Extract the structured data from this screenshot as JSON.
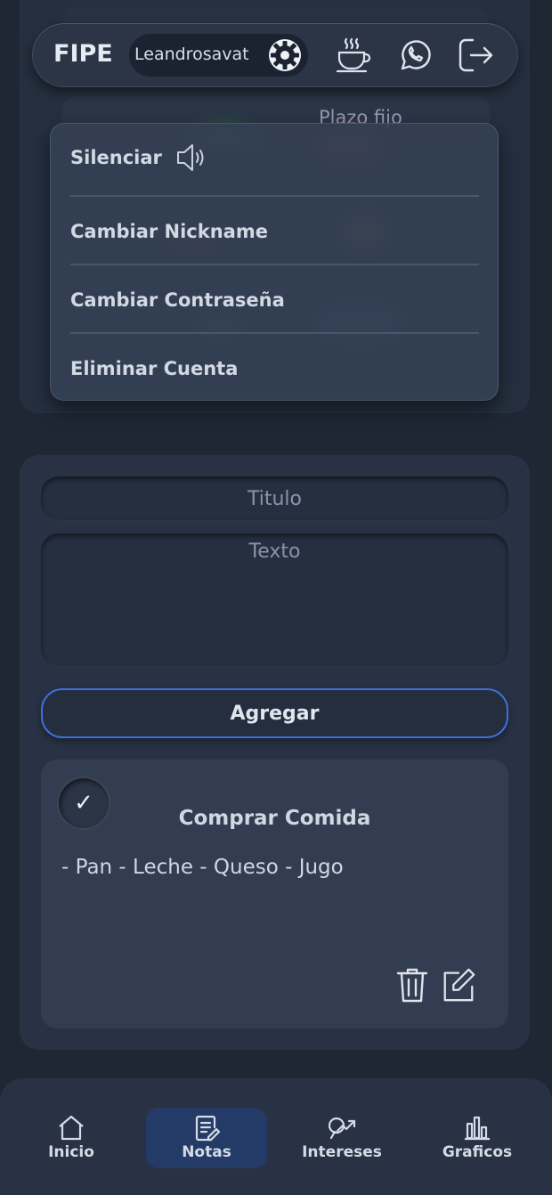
{
  "header": {
    "brand": "FIPE",
    "username": "Leandrosavat"
  },
  "background": {
    "partial_label": "Plazo fijo"
  },
  "menu": {
    "items": [
      {
        "label": "Silenciar"
      },
      {
        "label": "Cambiar Nickname"
      },
      {
        "label": "Cambiar Contraseña"
      },
      {
        "label": "Eliminar Cuenta"
      }
    ]
  },
  "form": {
    "title_placeholder": "Titulo",
    "text_placeholder": "Texto",
    "add_label": "Agregar"
  },
  "note": {
    "checked": true,
    "check_mark": "✓",
    "title": "Comprar Comida",
    "body": "- Pan - Leche - Queso - Jugo"
  },
  "nav": {
    "items": [
      {
        "label": "Inicio",
        "icon": "home-icon"
      },
      {
        "label": "Notas",
        "icon": "notes-icon",
        "active": true
      },
      {
        "label": "Intereses",
        "icon": "interests-icon"
      },
      {
        "label": "Graficos",
        "icon": "chart-icon"
      }
    ]
  },
  "colors": {
    "background": "#1f2735",
    "card": "#283244",
    "accent_border": "#3e6fd8",
    "active_nav": "#233b66"
  }
}
